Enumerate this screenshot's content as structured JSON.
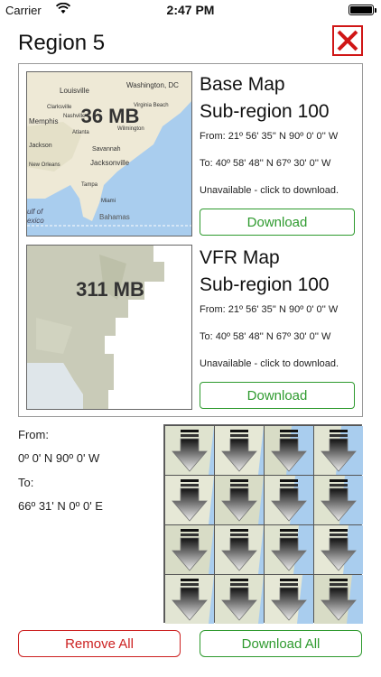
{
  "status": {
    "carrier": "Carrier",
    "time": "2:47 PM"
  },
  "header": {
    "title": "Region 5"
  },
  "maps": [
    {
      "size": "36 MB",
      "title_line1": "Base Map",
      "title_line2": "Sub-region 100",
      "from": "From: 21º 56' 35'' N 90º 0' 0'' W",
      "to": "To: 40º 58' 48'' N 67º 30' 0'' W",
      "status": "Unavailable - click to download.",
      "button": "Download",
      "places": [
        "Louisville",
        "Washington, DC",
        "Clarksville",
        "Virginia Beach",
        "Memphis",
        "Nashville",
        "Wilmington",
        "Atlanta",
        "Jackson",
        "Savannah",
        "New Orleans",
        "Jacksonville",
        "Tampa",
        "Miami",
        "Bahamas",
        "ulf of",
        "exico"
      ]
    },
    {
      "size": "311 MB",
      "title_line1": "VFR Map",
      "title_line2": "Sub-region 100",
      "from": "From: 21º 56' 35'' N 90º 0' 0'' W",
      "to": "To: 40º 58' 48'' N 67º 30' 0'' W",
      "status": "Unavailable - click to download.",
      "button": "Download"
    }
  ],
  "region": {
    "from_label": "From:",
    "from_value": "0º 0' N 90º 0' W",
    "to_label": "To:",
    "to_value": "66º 31' N 0º 0' E"
  },
  "grid": {
    "rows": 4,
    "cols": 4,
    "tile_icon": "download-arrow-icon"
  },
  "actions": {
    "remove_all": "Remove All",
    "download_all": "Download All"
  },
  "colors": {
    "green": "#2e9a2e",
    "red": "#cc2020"
  }
}
